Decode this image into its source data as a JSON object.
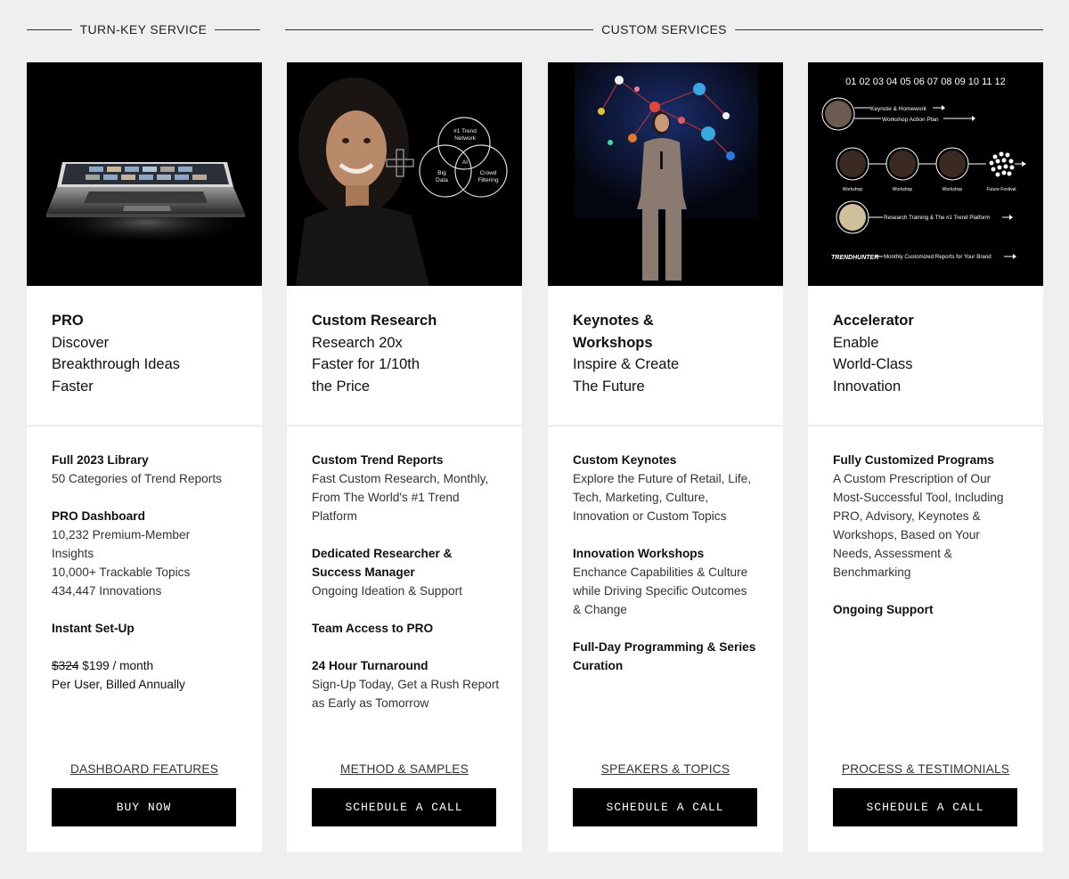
{
  "sections": {
    "turnkey": "TURN-KEY SERVICE",
    "custom": "CUSTOM SERVICES"
  },
  "cards": [
    {
      "title": "PRO",
      "subtitle": [
        "Discover",
        "Breakthrough Ideas",
        "Faster"
      ],
      "features": [
        {
          "title": "Full 2023 Library",
          "lines": [
            "50 Categories of Trend Reports"
          ]
        },
        {
          "title": "PRO Dashboard",
          "lines": [
            "10,232 Premium-Member",
            "Insights",
            "10,000+ Trackable Topics",
            "434,447 Innovations"
          ]
        },
        {
          "title": "Instant Set-Up",
          "lines": []
        }
      ],
      "price": {
        "old": "$324",
        "new": "$199 / month",
        "note": "Per User, Billed Annually"
      },
      "link": "DASHBOARD FEATURES",
      "cta": "BUY NOW"
    },
    {
      "title": "Custom Research",
      "subtitle": [
        "Research 20x",
        "Faster for 1/10th",
        "the Price"
      ],
      "image_labels": {
        "top": "#1 Trend",
        "top2": "Network",
        "left": "Big",
        "left2": "Data",
        "center": "AI",
        "right": "Crowd",
        "right2": "Filtering"
      },
      "features": [
        {
          "title": "Custom Trend Reports",
          "lines": [
            "Fast Custom Research, Monthly,",
            "From The World's #1 Trend",
            "Platform"
          ]
        },
        {
          "title": "Dedicated Researcher &",
          "title2": "Success Manager",
          "lines": [
            "Ongoing Ideation & Support"
          ]
        },
        {
          "title": "Team Access to PRO",
          "lines": []
        },
        {
          "title": "24 Hour Turnaround",
          "lines": [
            "Sign-Up Today, Get a Rush Report",
            "as Early as Tomorrow"
          ]
        }
      ],
      "link": "METHOD & SAMPLES",
      "cta": "SCHEDULE A CALL"
    },
    {
      "title": "Keynotes &",
      "title2": "Workshops",
      "subtitle": [
        "Inspire & Create",
        "The Future"
      ],
      "features": [
        {
          "title": "Custom Keynotes",
          "lines": [
            "Explore the Future of Retail, Life,",
            "Tech, Marketing, Culture,",
            "Innovation or Custom Topics"
          ]
        },
        {
          "title": "Innovation Workshops",
          "lines": [
            "Enchance Capabilities & Culture",
            "while Driving Specific Outcomes",
            "& Change"
          ]
        },
        {
          "title": "Full-Day Programming & Series",
          "title2": "Curation",
          "lines": []
        }
      ],
      "link": "SPEAKERS & TOPICS",
      "cta": "SCHEDULE A CALL"
    },
    {
      "title": "Accelerator",
      "subtitle": [
        "Enable",
        "World-Class",
        "Innovation"
      ],
      "image_labels": {
        "months": "01 02 03 04 05 06 07 08 09 10 11 12",
        "keynote": "Keynote & Homework",
        "action": "Workshop Action Plan",
        "workshop": "Workshop",
        "festival": "Future Festival",
        "training": "Research Training & The #1 Trend Platform",
        "brand": "TRENDHUNTER",
        "monthly": "Monthly Customized Reports for Your Brand"
      },
      "features": [
        {
          "title": "Fully Customized Programs",
          "lines": [
            "A Custom Prescription of Our",
            "Most-Successful Tool, Including",
            "PRO, Advisory, Keynotes &",
            "Workshops, Based on Your",
            "Needs, Assessment &",
            "Benchmarking"
          ]
        },
        {
          "title": "Ongoing Support",
          "lines": []
        }
      ],
      "link": "PROCESS & TESTIMONIALS",
      "cta": "SCHEDULE A CALL"
    }
  ]
}
